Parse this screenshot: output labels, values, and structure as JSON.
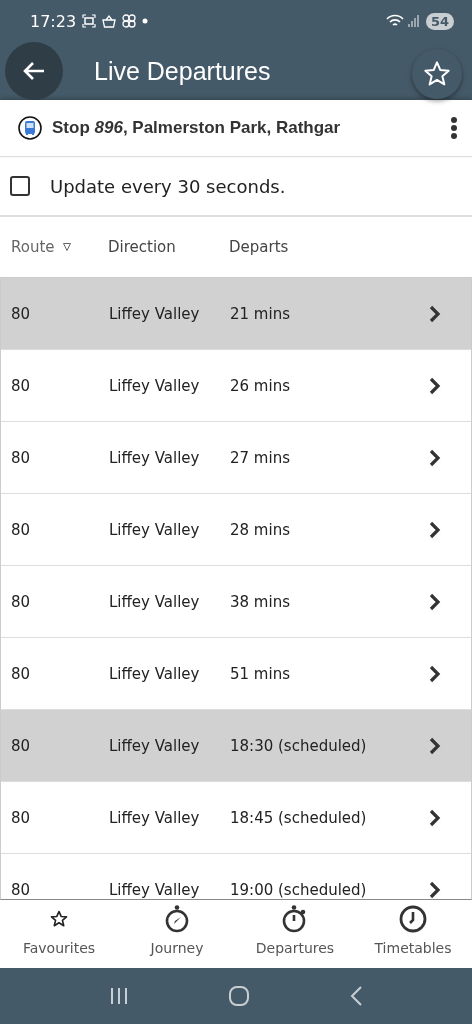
{
  "status_bar": {
    "time": "17:23",
    "battery": "54"
  },
  "app_bar": {
    "title": "Live Departures"
  },
  "stop": {
    "title": "Stop *896*, Palmerston Park, Rathgar"
  },
  "auto_update": {
    "label": "Update every 30 seconds.",
    "checked": false
  },
  "table": {
    "columns": [
      {
        "label": "Route",
        "sortable": true
      },
      {
        "label": "Direction",
        "sortable": false
      },
      {
        "label": "Departs",
        "sortable": false
      }
    ],
    "rows": [
      {
        "route": "80",
        "direction": "Liffey Valley",
        "departs": "21 mins",
        "highlighted": true
      },
      {
        "route": "80",
        "direction": "Liffey Valley",
        "departs": "26 mins",
        "highlighted": false
      },
      {
        "route": "80",
        "direction": "Liffey Valley",
        "departs": "27 mins",
        "highlighted": false
      },
      {
        "route": "80",
        "direction": "Liffey Valley",
        "departs": "28 mins",
        "highlighted": false
      },
      {
        "route": "80",
        "direction": "Liffey Valley",
        "departs": "38 mins",
        "highlighted": false
      },
      {
        "route": "80",
        "direction": "Liffey Valley",
        "departs": "51 mins",
        "highlighted": false
      },
      {
        "route": "80",
        "direction": "Liffey Valley",
        "departs": "18:30 (scheduled)",
        "highlighted": true
      },
      {
        "route": "80",
        "direction": "Liffey Valley",
        "departs": "18:45 (scheduled)",
        "highlighted": false
      },
      {
        "route": "80",
        "direction": "Liffey Valley",
        "departs": "19:00 (scheduled)",
        "highlighted": false
      }
    ]
  },
  "bottom_nav": [
    {
      "label": "Favourites",
      "kind": "star",
      "selected": false
    },
    {
      "label": "Journey",
      "kind": "compass",
      "selected": false
    },
    {
      "label": "Departures",
      "kind": "timer",
      "selected": false
    },
    {
      "label": "Timetables",
      "kind": "clock",
      "selected": false
    }
  ]
}
